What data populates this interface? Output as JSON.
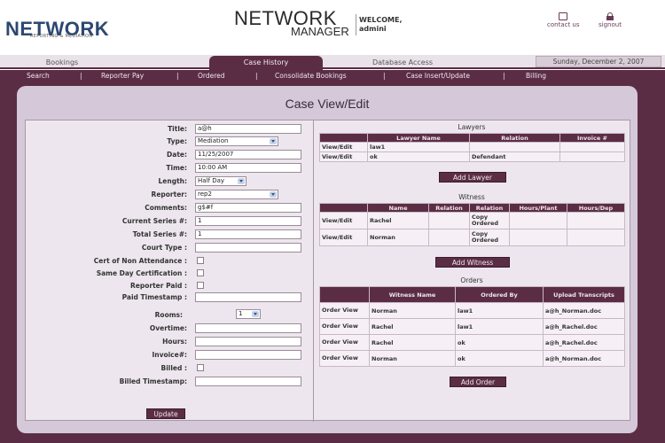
{
  "header": {
    "logo_main": "NETWORK",
    "logo_sub": "REPORTING & MEDIATION",
    "app_title_line1": "NETWORK",
    "app_title_line2": "MANAGER",
    "welcome_label": "WELCOME,",
    "welcome_user": "admini",
    "contact_label": "contact us",
    "signout_label": "signout"
  },
  "tabs": [
    {
      "label": "Bookings"
    },
    {
      "label": "Case History"
    },
    {
      "label": "Database Access"
    }
  ],
  "date_display": "Sunday, December 2, 2007",
  "subnav": [
    "Search",
    "Reporter Pay",
    "Ordered",
    "Consolidate Bookings",
    "Case Insert/Update",
    "Billing"
  ],
  "page_title": "Case View/Edit",
  "form": {
    "title": {
      "label": "Title:",
      "value": "a@h"
    },
    "type": {
      "label": "Type:",
      "value": "Mediation"
    },
    "date": {
      "label": "Date:",
      "value": "11/25/2007"
    },
    "time": {
      "label": "Time:",
      "value": "10:00 AM"
    },
    "length": {
      "label": "Length:",
      "value": "Half Day"
    },
    "reporter": {
      "label": "Reporter:",
      "value": "rep2"
    },
    "comments": {
      "label": "Comments:",
      "value": "g$#f"
    },
    "current_series": {
      "label": "Current Series #:",
      "value": "1"
    },
    "total_series": {
      "label": "Total Series #:",
      "value": "1"
    },
    "court_type": {
      "label": "Court Type :",
      "value": ""
    },
    "cert_non_attendance": {
      "label": "Cert of Non Attendance :"
    },
    "same_day_cert": {
      "label": "Same Day Certification :"
    },
    "reporter_paid": {
      "label": "Reporter Paid :"
    },
    "paid_timestamp": {
      "label": "Paid Timestamp :",
      "value": ""
    },
    "rooms": {
      "label": "Rooms:",
      "value": "1"
    },
    "overtime": {
      "label": "Overtime:",
      "value": ""
    },
    "hours": {
      "label": "Hours:",
      "value": ""
    },
    "invoice": {
      "label": "Invoice#:",
      "value": ""
    },
    "billed": {
      "label": "Billed :"
    },
    "billed_timestamp": {
      "label": "Billed Timestamp:",
      "value": ""
    },
    "update_button": "Update"
  },
  "lawyers": {
    "title": "Lawyers",
    "headers": [
      "",
      "Lawyer Name",
      "Relation",
      "Invoice #"
    ],
    "rows": [
      {
        "action": "View/Edit",
        "name": "law1",
        "relation": "",
        "invoice": ""
      },
      {
        "action": "View/Edit",
        "name": "ok",
        "relation": "Defendant",
        "invoice": ""
      }
    ],
    "add_button": "Add Lawyer"
  },
  "witness": {
    "title": "Witness",
    "headers": [
      "",
      "Name",
      "Relation",
      "Relation",
      "Hours/Plant",
      "Hours/Dep"
    ],
    "rows": [
      {
        "action": "View/Edit",
        "name": "Rachel",
        "relation": "",
        "status": "Copy Ordered",
        "hours_plant": "",
        "hours_dep": ""
      },
      {
        "action": "View/Edit",
        "name": "Norman",
        "relation": "",
        "status": "Copy Ordered",
        "hours_plant": "",
        "hours_dep": ""
      }
    ],
    "add_button": "Add Witness"
  },
  "orders": {
    "title": "Orders",
    "headers": [
      "",
      "Witness Name",
      "Ordered By",
      "Upload Transcripts"
    ],
    "rows": [
      {
        "action": "Order View",
        "witness": "Norman",
        "ordered_by": "law1",
        "file": "a@h_Norman.doc"
      },
      {
        "action": "Order View",
        "witness": "Rachel",
        "ordered_by": "law1",
        "file": "a@h_Rachel.doc"
      },
      {
        "action": "Order View",
        "witness": "Rachel",
        "ordered_by": "ok",
        "file": "a@h_Rachel.doc"
      },
      {
        "action": "Order View",
        "witness": "Norman",
        "ordered_by": "ok",
        "file": "a@h_Norman.doc"
      }
    ],
    "add_button": "Add Order"
  },
  "colors": {
    "brand_plum": "#5b2d45",
    "panel_bg": "#d4c8d9",
    "form_bg": "#ede6ee",
    "logo_blue": "#2c4870"
  }
}
